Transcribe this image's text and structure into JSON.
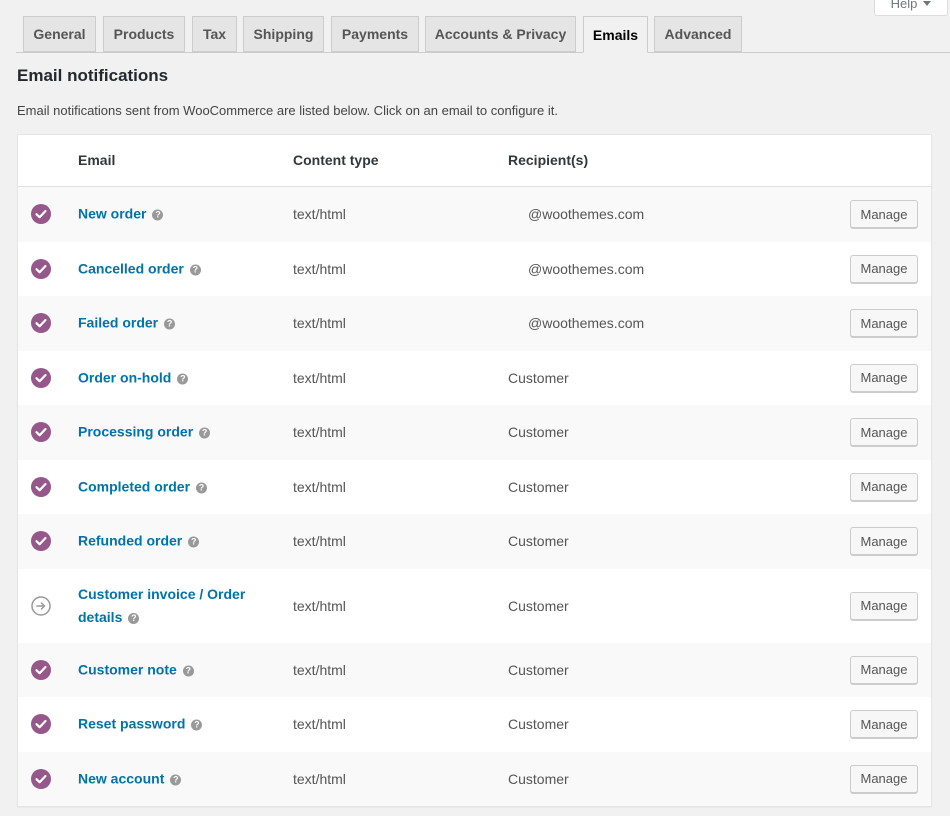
{
  "help": {
    "label": "Help"
  },
  "tabs": [
    {
      "label": "General",
      "active": false
    },
    {
      "label": "Products",
      "active": false
    },
    {
      "label": "Tax",
      "active": false
    },
    {
      "label": "Shipping",
      "active": false
    },
    {
      "label": "Payments",
      "active": false
    },
    {
      "label": "Accounts & Privacy",
      "active": false
    },
    {
      "label": "Emails",
      "active": true
    },
    {
      "label": "Advanced",
      "active": false
    }
  ],
  "page": {
    "title": "Email notifications",
    "description": "Email notifications sent from WooCommerce are listed below. Click on an email to configure it."
  },
  "table": {
    "headers": {
      "email": "Email",
      "content_type": "Content type",
      "recipients": "Recipient(s)"
    },
    "manage_label": "Manage",
    "help_icon_glyph": "?",
    "rows": [
      {
        "name": "New order",
        "status": "enabled",
        "content_type": "text/html",
        "recipient": "@woothemes.com"
      },
      {
        "name": "Cancelled order",
        "status": "enabled",
        "content_type": "text/html",
        "recipient": "@woothemes.com"
      },
      {
        "name": "Failed order",
        "status": "enabled",
        "content_type": "text/html",
        "recipient": "@woothemes.com"
      },
      {
        "name": "Order on-hold",
        "status": "enabled",
        "content_type": "text/html",
        "recipient": "Customer"
      },
      {
        "name": "Processing order",
        "status": "enabled",
        "content_type": "text/html",
        "recipient": "Customer"
      },
      {
        "name": "Completed order",
        "status": "enabled",
        "content_type": "text/html",
        "recipient": "Customer"
      },
      {
        "name": "Refunded order",
        "status": "enabled",
        "content_type": "text/html",
        "recipient": "Customer"
      },
      {
        "name": "Customer invoice / Order details",
        "status": "manual",
        "content_type": "text/html",
        "recipient": "Customer"
      },
      {
        "name": "Customer note",
        "status": "enabled",
        "content_type": "text/html",
        "recipient": "Customer"
      },
      {
        "name": "Reset password",
        "status": "enabled",
        "content_type": "text/html",
        "recipient": "Customer"
      },
      {
        "name": "New account",
        "status": "enabled",
        "content_type": "text/html",
        "recipient": "Customer"
      }
    ]
  },
  "colors": {
    "enabled": "#96588a",
    "manual": "#999999",
    "link": "#0073aa"
  }
}
